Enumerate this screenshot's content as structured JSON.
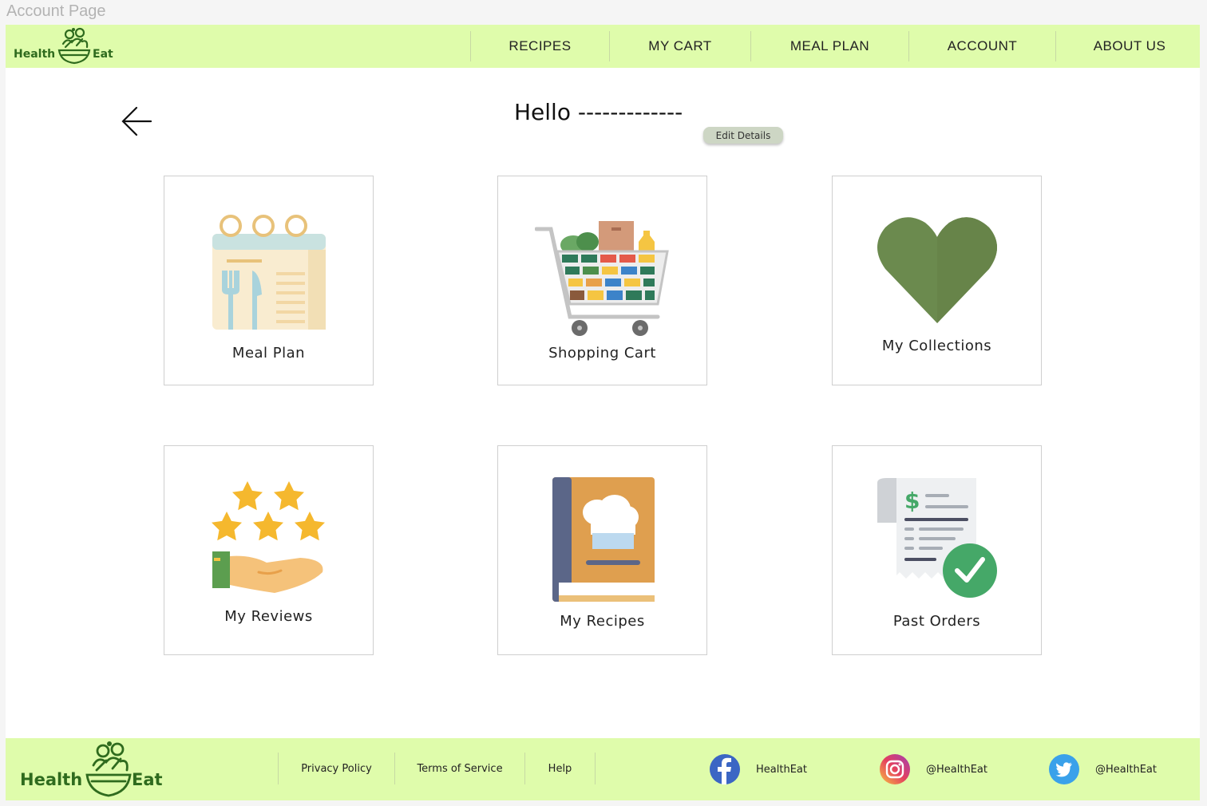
{
  "frame_title": "Account Page",
  "brand": {
    "left_word": "Health",
    "right_word": "Eat",
    "accent": "#2f6b1e",
    "bar_color": "#dffcab"
  },
  "nav": {
    "items": [
      "RECIPES",
      "MY CART",
      "MEAL PLAN",
      "ACCOUNT",
      "ABOUT US"
    ]
  },
  "header": {
    "greeting": "Hello -------------",
    "edit_label": "Edit Details"
  },
  "cards": [
    {
      "label": "Meal Plan",
      "icon": "calendar-icon"
    },
    {
      "label": "Shopping Cart",
      "icon": "shopping-cart-icon"
    },
    {
      "label": "My Collections",
      "icon": "heart-icon"
    },
    {
      "label": "My Reviews",
      "icon": "stars-hand-icon"
    },
    {
      "label": "My Recipes",
      "icon": "recipe-book-icon"
    },
    {
      "label": "Past Orders",
      "icon": "receipt-check-icon"
    }
  ],
  "footer": {
    "links": [
      "Privacy Policy",
      "Terms of Service",
      "Help"
    ],
    "social": [
      {
        "network": "facebook",
        "handle": "HealthEat",
        "icon": "facebook-icon"
      },
      {
        "network": "instagram",
        "handle": "@HealthEat",
        "icon": "instagram-icon"
      },
      {
        "network": "twitter",
        "handle": "@HealthEat",
        "icon": "twitter-icon"
      }
    ]
  }
}
